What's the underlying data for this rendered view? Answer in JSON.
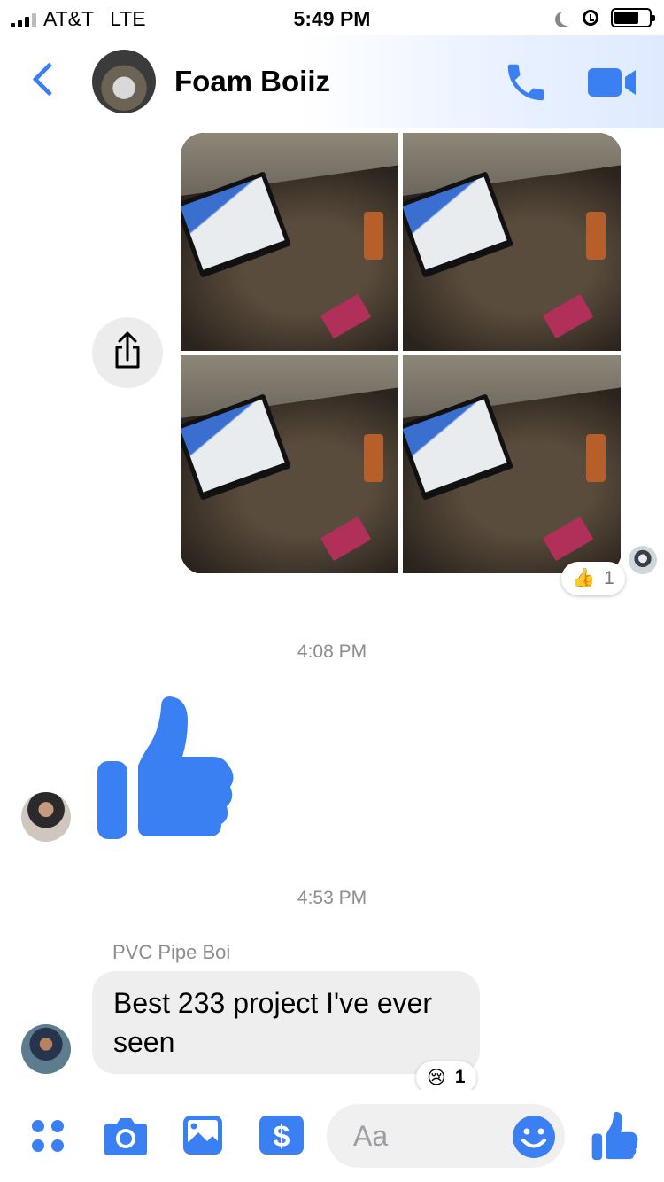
{
  "status_bar": {
    "carrier": "AT&T",
    "network": "LTE",
    "time": "5:49 PM"
  },
  "header": {
    "title": "Foam Boiiz"
  },
  "photo_message": {
    "reaction": {
      "emoji": "👍",
      "count": "1"
    }
  },
  "timestamps": [
    "4:08 PM",
    "4:53 PM"
  ],
  "text_message": {
    "sender": "PVC Pipe Boi",
    "text": "Best 233 project I've ever seen",
    "reaction": {
      "emoji": "😢",
      "count": "1"
    }
  },
  "composer": {
    "placeholder": "Aa"
  },
  "colors": {
    "accent": "#3a80f2",
    "bubble": "#eeeeef",
    "timestamp": "#8a8d91"
  }
}
